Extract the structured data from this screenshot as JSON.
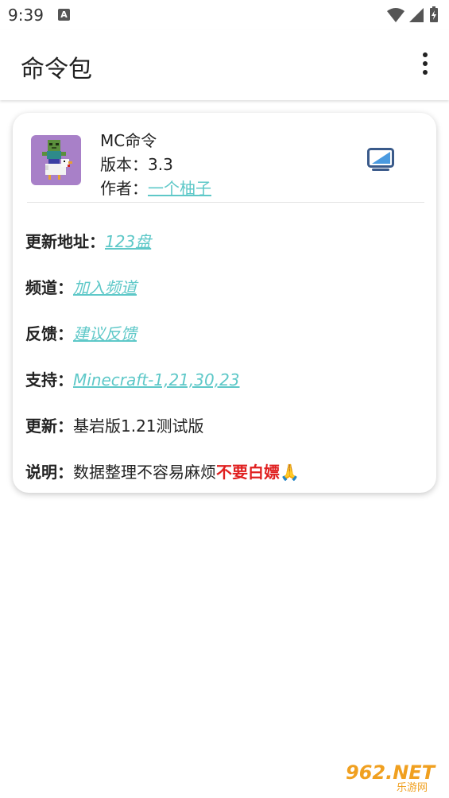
{
  "status_bar": {
    "time": "9:39",
    "notification_icon": "A"
  },
  "app_bar": {
    "title": "命令包",
    "menu_icon": "more-vert-icon"
  },
  "package": {
    "name": "MC命令",
    "version_label": "版本：",
    "version": "3.3",
    "author_label": "作者：",
    "author": "一个柚子"
  },
  "details": {
    "update_url_label": "更新地址：",
    "update_url": "123盘",
    "channel_label": "频道：",
    "channel": "加入频道",
    "feedback_label": "反馈：",
    "feedback": "建议反馈",
    "support_label": "支持：",
    "support": "Minecraft-1,21,30,23",
    "update_label": "更新：",
    "update": "基岩版1.21测试版",
    "desc_label": "说明：",
    "desc_text": "数据整理不容易麻烦",
    "desc_emphasis": "不要白嫖",
    "desc_emoji": "🙏"
  },
  "watermark": {
    "text": "962.NET",
    "sub": "乐游网"
  },
  "colors": {
    "link": "#5ec8c8",
    "emphasis": "#e02020",
    "icon_bg": "#a880c8"
  }
}
